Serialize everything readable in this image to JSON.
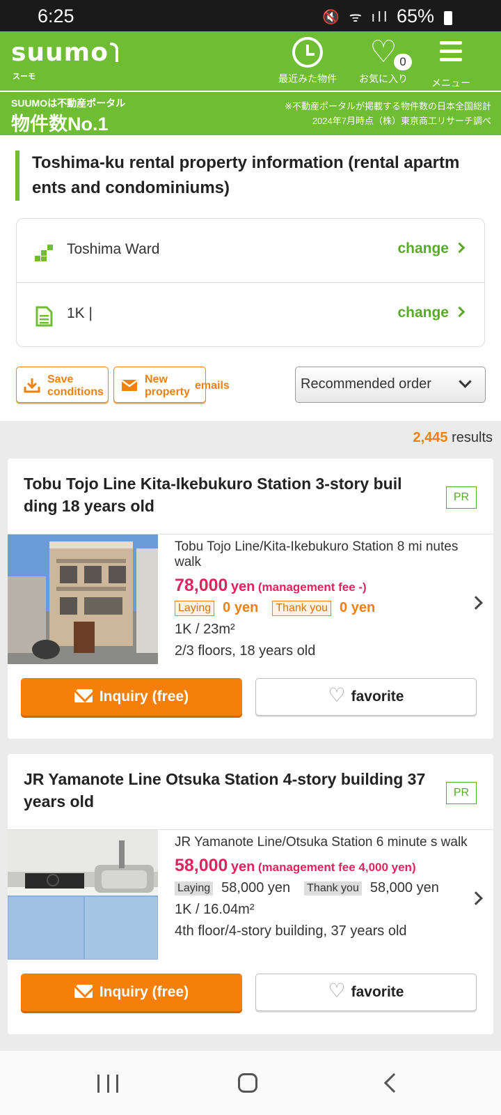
{
  "status_bar": {
    "time": "6:25",
    "battery": "65%"
  },
  "header": {
    "logo_text": "suumo",
    "logo_sub": "スーモ",
    "history_label": "最近みた物件",
    "favorites_label": "お気に入り",
    "favorites_count": "0",
    "menu_label": "メニュー"
  },
  "banner": {
    "line1": "SUUMOは不動産ポータル",
    "line2": "物件数No.1",
    "note1": "※不動産ポータルが掲載する物件数の日本全国総計",
    "note2": "2024年7月時点（株）東京商工リサーチ調べ"
  },
  "page": {
    "title": "Toshima-ku rental property information (rental apartm ents and condominiums)"
  },
  "conditions": {
    "area": "Toshima Ward",
    "area_change": "change",
    "layout": "1K |",
    "layout_change": "change"
  },
  "actions": {
    "save_line1": "Save",
    "save_line2": "conditions",
    "new_line1": "New",
    "new_line2": "property",
    "emails": "emails",
    "sort_selected": "Recommended order"
  },
  "results": {
    "count": "2,445",
    "label": "results"
  },
  "listings": [
    {
      "title": "Tobu Tojo Line Kita-Ikebukuro Station 3-story buil ding 18 years old",
      "pr": "PR",
      "access": "Tobu Tojo Line/Kita-Ikebukuro Station 8 mi nutes walk",
      "rent_amount": "78,000",
      "rent_unit": "yen",
      "mgmt_fee": "(management fee -)",
      "deposit_label": "Laying",
      "deposit_value": "0 yen",
      "key_money_label": "Thank you",
      "key_money_value": "0 yen",
      "layout": "1K / 23m²",
      "floor": "2/3 floors, 18 years old",
      "inquiry": "Inquiry (free)",
      "favorite": "favorite"
    },
    {
      "title": "JR Yamanote Line Otsuka Station 4-story building 37 years old",
      "pr": "PR",
      "access": "JR Yamanote Line/Otsuka Station 6 minute s walk",
      "rent_amount": "58,000",
      "rent_unit": "yen",
      "mgmt_fee": "(management fee 4,000 yen)",
      "deposit_label": "Laying",
      "deposit_value": "58,000 yen",
      "key_money_label": "Thank you",
      "key_money_value": "58,000 yen",
      "layout": "1K / 16.04m²",
      "floor": "4th floor/4-story building, 37 years old",
      "inquiry": "Inquiry (free)",
      "favorite": "favorite"
    }
  ],
  "colors": {
    "brand_green": "#6ebd33",
    "accent_orange": "#f57f0a",
    "price_pink": "#e0245e"
  }
}
